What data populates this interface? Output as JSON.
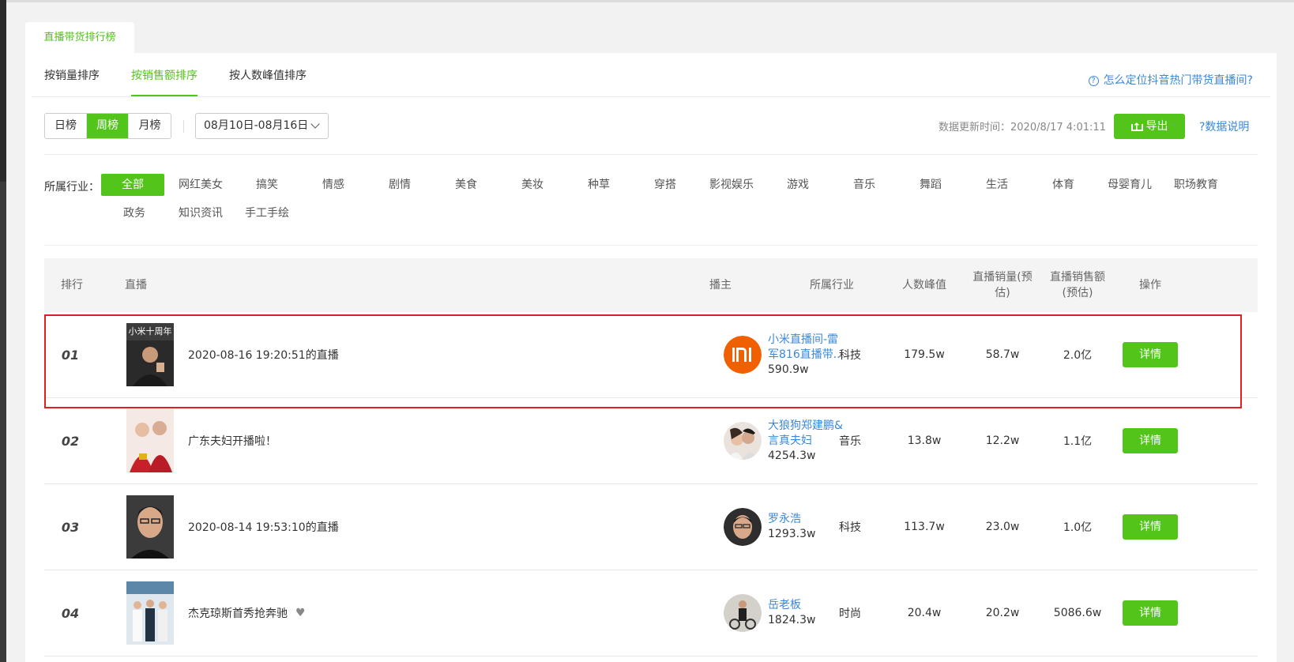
{
  "panel_tab": "直播带货排行榜",
  "sort_tabs": [
    "按销量排序",
    "按销售额排序",
    "按人数峰值排序"
  ],
  "help_link": "怎么定位抖音热门带货直播间?",
  "period_buttons": [
    "日榜",
    "周榜",
    "月榜"
  ],
  "period_active": "周榜",
  "date_range": "08月10日-08月16日",
  "update_time": "数据更新时间：2020/8/17 4:01:11",
  "export_label": "导出",
  "data_note": "?数据说明",
  "industry_label": "所属行业：",
  "industries_row1": [
    "全部",
    "网红美女",
    "搞笑",
    "情感",
    "剧情",
    "美食",
    "美妆",
    "种草",
    "穿搭",
    "影视娱乐",
    "游戏",
    "音乐",
    "舞蹈",
    "生活",
    "体育",
    "母婴育儿",
    "职场教育"
  ],
  "industries_row2": [
    "政务",
    "知识资讯",
    "手工手绘"
  ],
  "table": {
    "headers": {
      "rank": "排行",
      "live": "直播",
      "host": "播主",
      "industry": "所属行业",
      "peak": "人数峰值",
      "sales_volume": "直播销量(预估)",
      "sales_amount": "直播销售额(预估)",
      "action": "操作"
    },
    "rows": [
      {
        "rank": "01",
        "title": "2020-08-16 19:20:51的直播",
        "host_name": "小米直播间-雷军816直播带...",
        "host_fans": "590.9w",
        "industry": "科技",
        "peak": "179.5w",
        "volume": "58.7w",
        "amount": "2.0亿",
        "action": "详情"
      },
      {
        "rank": "02",
        "title": "广东夫妇开播啦！",
        "host_name": "大狼狗郑建鹏&言真夫妇",
        "host_fans": "4254.3w",
        "industry": "音乐",
        "peak": "13.8w",
        "volume": "12.2w",
        "amount": "1.1亿",
        "action": "详情"
      },
      {
        "rank": "03",
        "title": "2020-08-14 19:53:10的直播",
        "host_name": "罗永浩",
        "host_fans": "1293.3w",
        "industry": "科技",
        "peak": "113.7w",
        "volume": "23.0w",
        "amount": "1.0亿",
        "action": "详情"
      },
      {
        "rank": "04",
        "title": "杰克琼斯首秀抢奔驰",
        "host_name": "岳老板",
        "host_fans": "1824.3w",
        "industry": "时尚",
        "peak": "20.4w",
        "volume": "20.2w",
        "amount": "5086.6w",
        "action": "详情"
      }
    ]
  },
  "colors": {
    "accent": "#52c41a",
    "link": "#3b88d8",
    "highlight": "#e02020"
  }
}
